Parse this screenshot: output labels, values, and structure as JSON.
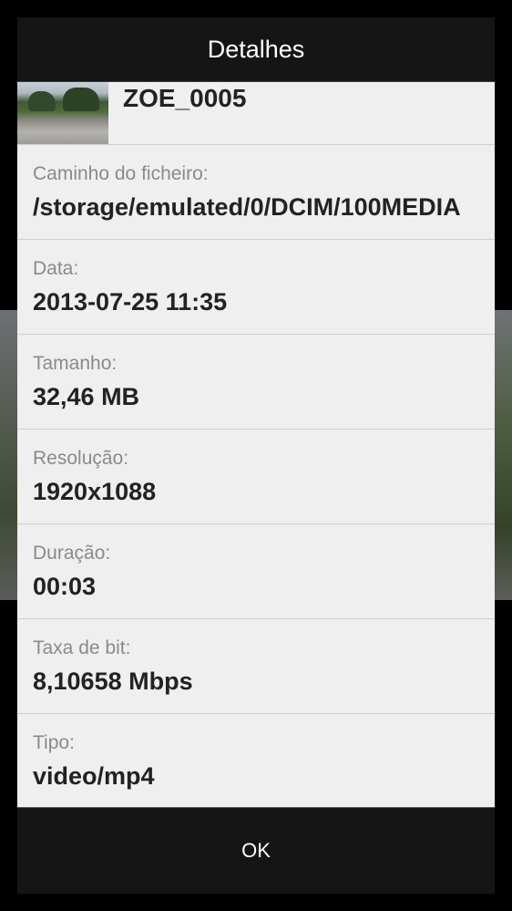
{
  "dialog": {
    "title": "Detalhes",
    "file_name": "ZOE_0005",
    "details": [
      {
        "label": "Caminho do ficheiro:",
        "value": "/storage/emulated/0/DCIM/100MEDIA"
      },
      {
        "label": "Data:",
        "value": "2013-07-25 11:35"
      },
      {
        "label": "Tamanho:",
        "value": "32,46 MB"
      },
      {
        "label": "Resolução:",
        "value": "1920x1088"
      },
      {
        "label": "Duração:",
        "value": "00:03"
      },
      {
        "label": "Taxa de bit:",
        "value": "8,10658 Mbps"
      },
      {
        "label": "Tipo:",
        "value": "video/mp4"
      }
    ],
    "ok_label": "OK"
  },
  "colors": {
    "title_bar": "#151515",
    "dialog_body": "#efefef",
    "label_text": "#8a8a8a",
    "value_text": "#222222"
  }
}
